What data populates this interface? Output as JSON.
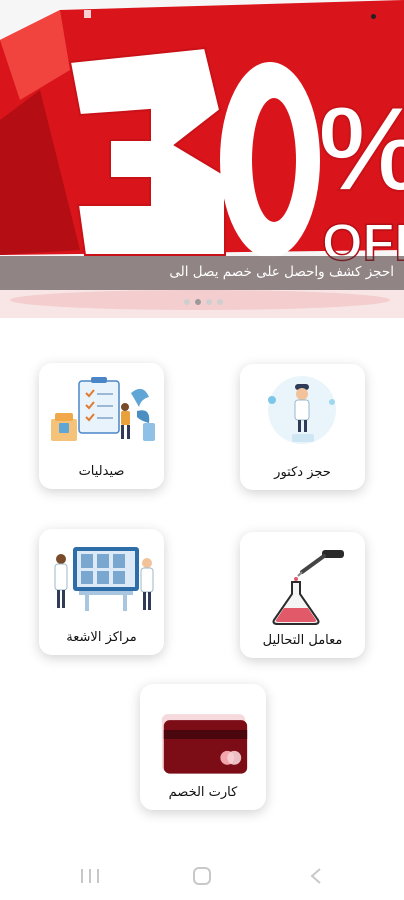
{
  "banner": {
    "big_text": "30",
    "percent": "%",
    "off_text": "OFF",
    "caption": "احجز كشف واحصل على خصم يصل الى",
    "slide_count": 4,
    "active_slide": 1
  },
  "services": [
    {
      "label": "حجز دكتور",
      "icon": "doctor-illustration"
    },
    {
      "label": "صيدليات",
      "icon": "pharmacy-checklist-illustration"
    },
    {
      "label": "معامل التحاليل",
      "icon": "lab-flask-illustration"
    },
    {
      "label": "مراكز الاشعة",
      "icon": "radiology-xray-illustration"
    },
    {
      "label": "كارت الخصم",
      "icon": "discount-card-illustration"
    }
  ],
  "nav": {
    "recents_icon": "recents-icon",
    "home_icon": "home-icon",
    "back_icon": "back-icon"
  },
  "colors": {
    "banner_red": "#e3141c",
    "card_maroon": "#7c0d17",
    "flask_liquid": "#e25a6a"
  }
}
